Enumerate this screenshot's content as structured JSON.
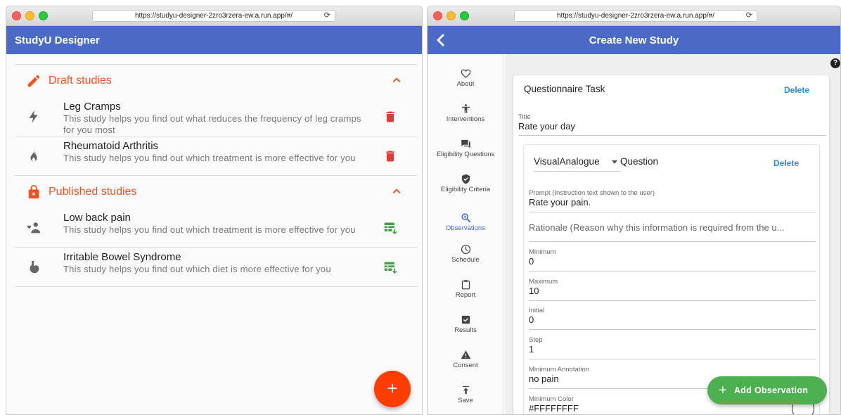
{
  "left_window": {
    "url": "https://studyu-designer-2zro3rzera-ew.a.run.app/#/",
    "app_title": "StudyU Designer",
    "sections": [
      {
        "title": "Draft studies",
        "icon": "pencil-icon",
        "items": [
          {
            "name": "Leg Cramps",
            "description": "This study helps you find out what reduces the frequency of leg cramps for you most",
            "icon": "bolt-icon",
            "action": "delete-icon"
          },
          {
            "name": "Rheumatoid Arthritis",
            "description": "This study helps you find out which treatment is more effective for you",
            "icon": "flame-icon",
            "action": "delete-icon"
          }
        ]
      },
      {
        "title": "Published studies",
        "icon": "lock-icon",
        "items": [
          {
            "name": "Low back pain",
            "description": "This study helps you find out which treatment is more effective for you",
            "icon": "person-heart-icon",
            "action": "table-download-icon"
          },
          {
            "name": "Irritable Bowel Syndrome",
            "description": "This study helps you find out which diet is more effective for you",
            "icon": "stomach-icon",
            "action": "table-download-icon"
          }
        ]
      }
    ],
    "fab_label": "+"
  },
  "right_window": {
    "url": "https://studyu-designer-2zro3rzera-ew.a.run.app/#/",
    "app_title": "Create New Study",
    "help_label": "?",
    "nav": [
      {
        "label": "About",
        "icon": "heart-icon",
        "active": false
      },
      {
        "label": "Interventions",
        "icon": "accessibility-icon",
        "active": false
      },
      {
        "label": "Eligibility Questions",
        "icon": "question-chat-icon",
        "active": false
      },
      {
        "label": "Eligibility Criteria",
        "icon": "verified-shield-icon",
        "active": false
      },
      {
        "label": "Observations",
        "icon": "search-zoom-icon",
        "active": true
      },
      {
        "label": "Schedule",
        "icon": "clock-icon",
        "active": false
      },
      {
        "label": "Report",
        "icon": "clipboard-icon",
        "active": false
      },
      {
        "label": "Results",
        "icon": "checkbox-icon",
        "active": false
      },
      {
        "label": "Consent",
        "icon": "warning-icon",
        "active": false
      },
      {
        "label": "Save",
        "icon": "upload-icon",
        "active": false
      }
    ],
    "task": {
      "title_text": "Questionnaire Task",
      "delete_label": "Delete",
      "title_field": {
        "label": "Title",
        "value": "Rate your day"
      }
    },
    "question": {
      "type_value": "VisualAnalogue",
      "type_suffix": "Question",
      "delete_label": "Delete",
      "prompt": {
        "label": "Prompt (Instruction text shown to the user)",
        "value": "Rate your pain."
      },
      "rationale_placeholder": "Rationale (Reason why this information is required from the u...",
      "minimum": {
        "label": "Minimum",
        "value": "0"
      },
      "maximum": {
        "label": "Maximum",
        "value": "10"
      },
      "initial": {
        "label": "Initial",
        "value": "0"
      },
      "step": {
        "label": "Step",
        "value": "1"
      },
      "minimum_annotation": {
        "label": "Minimum Annotation",
        "value": "no pain"
      },
      "minimum_color": {
        "label": "Minimum Color",
        "value": "#FFFFFFFF"
      }
    },
    "add_observation_label": "Add Observation"
  },
  "colors": {
    "app_bar": "#4a6ac6",
    "draft_accent": "#f4511e",
    "delete_red": "#e53935",
    "export_green": "#43a047",
    "fab_orange": "#ff3d00",
    "add_observation_green": "#4caf50",
    "link_blue": "#2a8be0",
    "nav_active": "#3d6ad6"
  }
}
